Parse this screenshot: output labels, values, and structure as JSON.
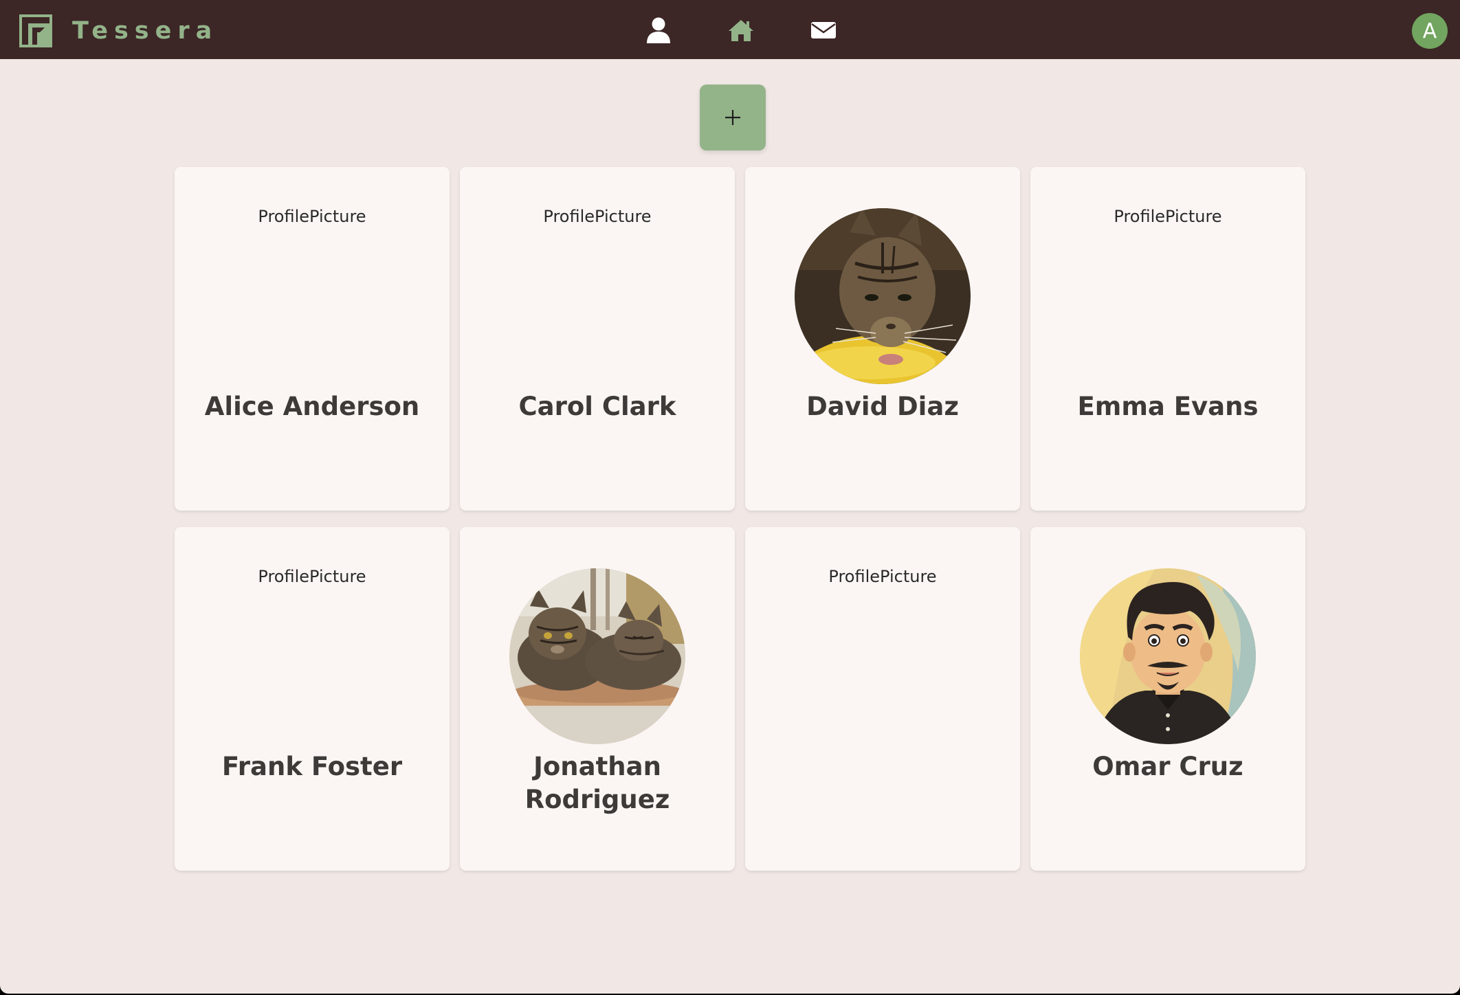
{
  "header": {
    "brand_name": "Tessera",
    "brand_icon": "tessera-logo",
    "nav": [
      {
        "name": "profile",
        "icon": "user-icon"
      },
      {
        "name": "home",
        "icon": "home-icon"
      },
      {
        "name": "messages",
        "icon": "envelope-icon"
      }
    ],
    "avatar_initial": "A"
  },
  "add_button": {
    "label": "+",
    "icon": "plus-icon"
  },
  "colors": {
    "header_bg": "#3c2626",
    "accent": "#93b389",
    "avatar_bg": "#72a55f",
    "page_bg": "#f1e8e5",
    "card_bg": "#fbf6f4"
  },
  "cards": [
    {
      "name": "Alice Anderson",
      "has_picture": false,
      "picture_alt": "ProfilePicture"
    },
    {
      "name": "Carol Clark",
      "has_picture": false,
      "picture_alt": "ProfilePicture"
    },
    {
      "name": "David Diaz",
      "has_picture": true,
      "picture": "tabby-cat-photo"
    },
    {
      "name": "Emma Evans",
      "has_picture": false,
      "picture_alt": "ProfilePicture"
    },
    {
      "name": "Frank Foster",
      "has_picture": false,
      "picture_alt": "ProfilePicture"
    },
    {
      "name": "Jonathan Rodriguez",
      "has_picture": true,
      "picture": "two-cats-photo"
    },
    {
      "name": "",
      "has_picture": false,
      "picture_alt": "ProfilePicture"
    },
    {
      "name": "Omar Cruz",
      "has_picture": true,
      "picture": "cartoon-man-avatar"
    }
  ]
}
